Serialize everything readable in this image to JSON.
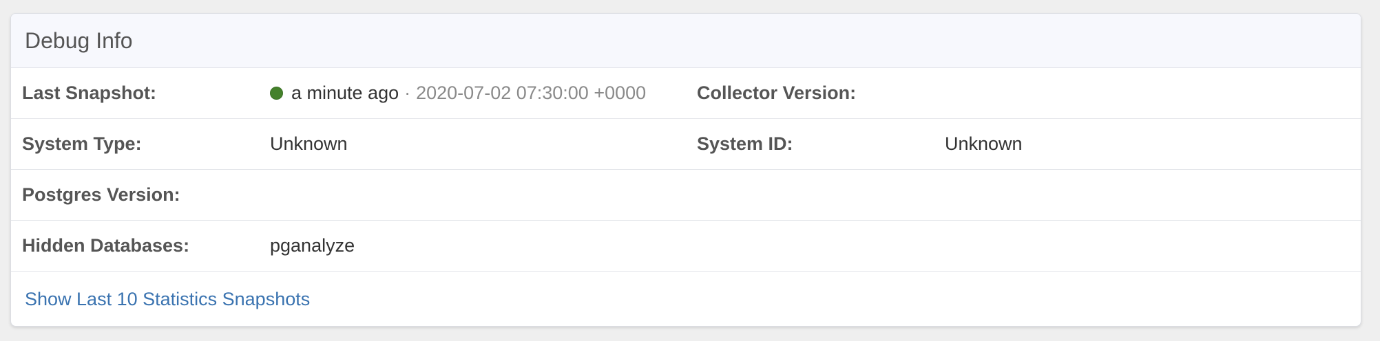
{
  "panel": {
    "title": "Debug Info"
  },
  "rows": [
    {
      "label1": "Last Snapshot:",
      "status_color": "#44812b",
      "relative_time": "a minute ago",
      "separator": "·",
      "timestamp": "2020-07-02 07:30:00 +0000",
      "label2": "Collector Version:",
      "value2": ""
    },
    {
      "label1": "System Type:",
      "value1": "Unknown",
      "label2": "System ID:",
      "value2": "Unknown"
    },
    {
      "label1": "Postgres Version:",
      "value1": ""
    },
    {
      "label1": "Hidden Databases:",
      "value1": "pganalyze"
    }
  ],
  "footer": {
    "link_label": "Show Last 10 Statistics Snapshots",
    "link_color": "#3a73b0"
  }
}
